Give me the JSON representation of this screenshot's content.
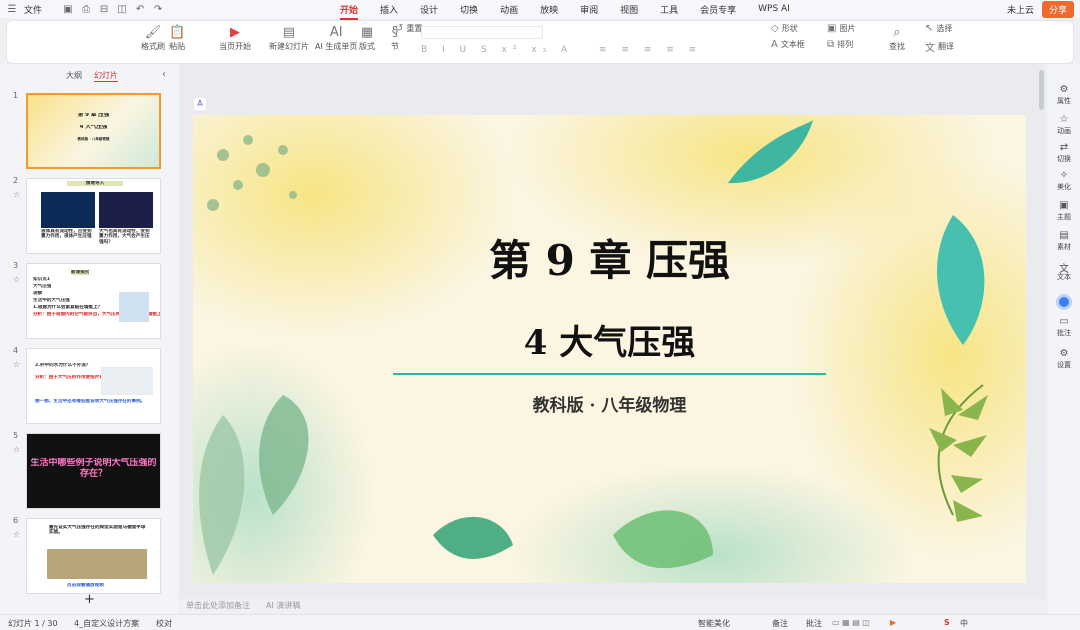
{
  "menubar": {
    "file": "文件",
    "tabs": [
      "开始",
      "插入",
      "设计",
      "切换",
      "动画",
      "放映",
      "审阅",
      "视图",
      "工具",
      "会员专享",
      "WPS AI"
    ],
    "active_tab": "开始",
    "cloud": "未上云",
    "share": "分享"
  },
  "ribbon": {
    "groups": [
      {
        "label": "格式刷",
        "icon": "format-painter-icon"
      },
      {
        "label": "粘贴",
        "icon": "paste-icon"
      },
      {
        "label": "当页开始",
        "icon": "play-icon"
      },
      {
        "label": "新建幻灯片",
        "icon": "new-slide-icon"
      },
      {
        "label": "AI 生成单页",
        "icon": "ai-icon"
      },
      {
        "label": "版式",
        "icon": "layout-icon"
      },
      {
        "label": "节",
        "icon": "section-icon"
      },
      {
        "label": "重置",
        "icon": "reset-icon"
      },
      {
        "label": "形状",
        "icon": "shape-icon"
      },
      {
        "label": "图片",
        "icon": "picture-icon"
      },
      {
        "label": "文本框",
        "icon": "textbox-icon"
      },
      {
        "label": "排列",
        "icon": "arrange-icon"
      },
      {
        "label": "查找",
        "icon": "search-icon"
      },
      {
        "label": "选择",
        "icon": "select-icon"
      },
      {
        "label": "翻译",
        "icon": "translate-icon"
      }
    ]
  },
  "sidebar": {
    "tabs": [
      "大纲",
      "幻灯片"
    ],
    "active_tab": "幻灯片",
    "slides": [
      {
        "num": "1",
        "texts": [
          "第 9 章 压强",
          "4 大气压强",
          "教科版 · 八年级物理"
        ]
      },
      {
        "num": "2",
        "texts": [
          "情境导入",
          "液体具有流动性，且受到重力作用，液体产生压强",
          "大气也具有流动性，受到重力作用，大气会产生压强吗？"
        ]
      },
      {
        "num": "3",
        "texts": [
          "新课探究",
          "知识点1",
          "大气压强",
          "观察",
          "生活中的大气压强",
          "1.吸盘为什么会紧紧贴在墙壁上？",
          "分析：由于吸盘内的空气被挤出，大气压将吸盘紧紧压在墙壁上。"
        ]
      },
      {
        "num": "4",
        "texts": [
          "2.杯中的水为什么不外流？",
          "分析：由于大气压的作用使纸片被压住不掉落",
          "点击播放视频",
          "想一想，生活中还有哪些能说明大气压强存在的事例。"
        ]
      },
      {
        "num": "5",
        "texts": [
          "生活中哪些例子说明大气压强的存在？"
        ]
      },
      {
        "num": "6",
        "texts": [
          "最先证实大气压强存在的典型实验是马德堡半球实验。",
          "点击观看播放视频"
        ]
      }
    ]
  },
  "slide": {
    "title": "第 9 章 压强",
    "subtitle": "4   大气压强",
    "caption": "教科版 · 八年级物理"
  },
  "notes": {
    "placeholder": "单击此处添加备注",
    "ai": "AI 演讲稿"
  },
  "rightbar": {
    "items": [
      {
        "label": "属性",
        "icon": "property-icon"
      },
      {
        "label": "动画",
        "icon": "animation-icon"
      },
      {
        "label": "切换",
        "icon": "transition-icon"
      },
      {
        "label": "美化",
        "icon": "beautify-icon"
      },
      {
        "label": "主题",
        "icon": "theme-icon"
      },
      {
        "label": "素材",
        "icon": "material-icon"
      },
      {
        "label": "文本",
        "icon": "text-icon"
      },
      {
        "label": "批注",
        "icon": "comment-icon"
      },
      {
        "label": "设置",
        "icon": "settings-icon"
      }
    ]
  },
  "status": {
    "slide_count": "幻灯片 1 / 30",
    "theme": "4_自定义设计方案",
    "proofread": "校对",
    "smart_beautify": "智能美化",
    "notes": "备注",
    "comments": "批注",
    "ime": "中"
  },
  "colors": {
    "accent": "#d33333",
    "share": "#ef6a2c",
    "selected_thumb": "#f39a2e",
    "slide_line": "#2fb3ab"
  }
}
